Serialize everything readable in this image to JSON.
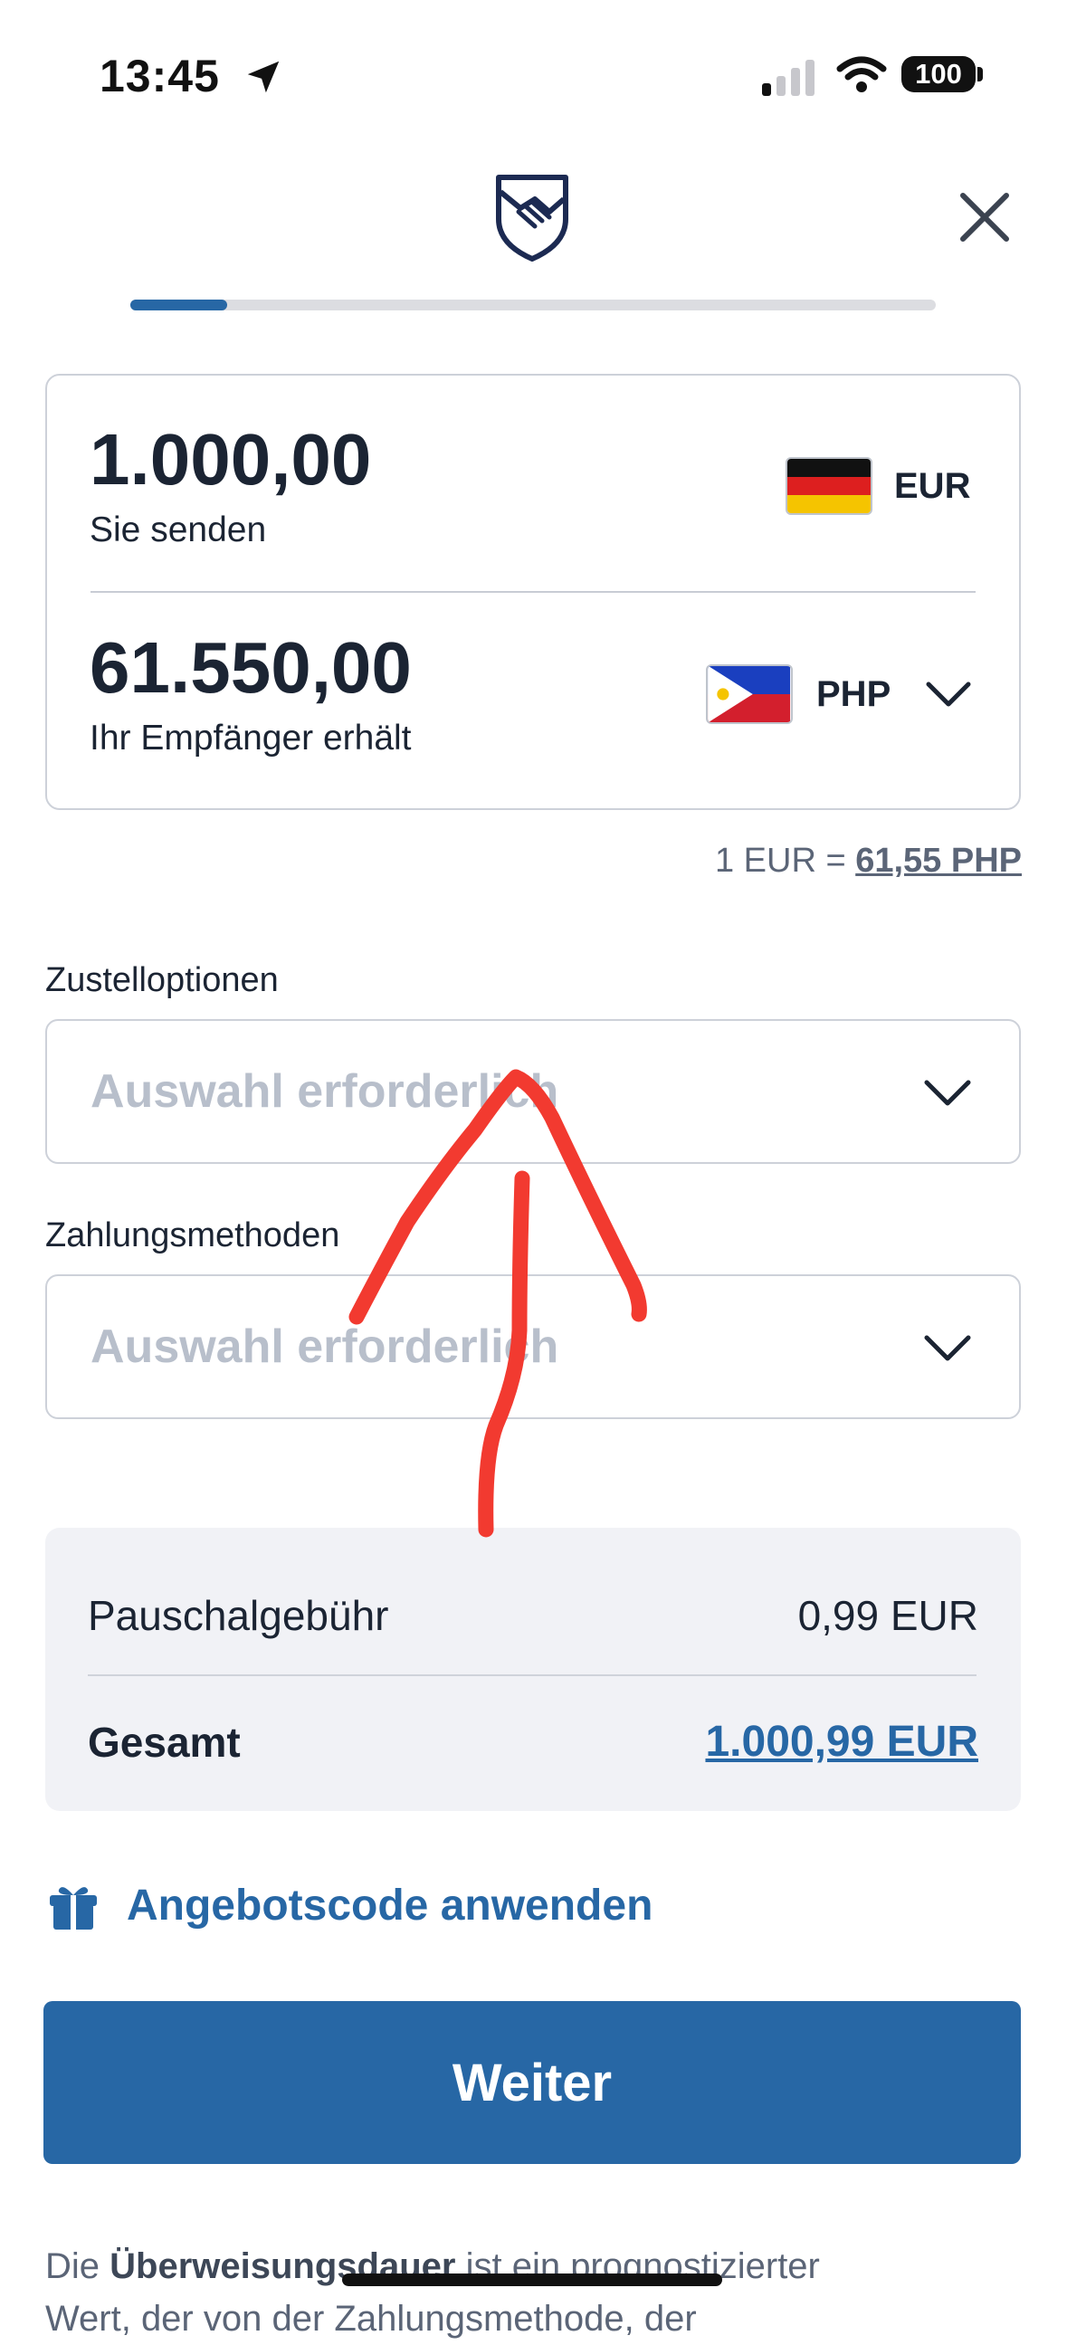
{
  "status_bar": {
    "time": "13:45",
    "battery": "100"
  },
  "progress": {
    "fraction": 0.12
  },
  "send": {
    "amount": "1.000,00",
    "label": "Sie senden",
    "currency": "EUR"
  },
  "receive": {
    "amount": "61.550,00",
    "label": "Ihr Empfänger erhält",
    "currency": "PHP"
  },
  "rate": {
    "prefix": "1 EUR = ",
    "value": "61,55 PHP"
  },
  "delivery": {
    "label": "Zustelloptionen",
    "placeholder": "Auswahl erforderlich"
  },
  "payment": {
    "label": "Zahlungsmethoden",
    "placeholder": "Auswahl erforderlich"
  },
  "summary": {
    "fee_label": "Pauschalgebühr",
    "fee_value": "0,99 EUR",
    "total_label": "Gesamt",
    "total_value": "1.000,99 EUR"
  },
  "promo": {
    "label": "Angebotscode anwenden"
  },
  "continue_button": {
    "label": "Weiter"
  },
  "footer": {
    "text_1": "Die ",
    "bold": "Überweisungsdauer",
    "text_2": " ist ein prognostizierter",
    "line_2": "Wert, der von der Zahlungsmethode, der"
  },
  "colors": {
    "accent": "#2767a5",
    "annotation": "#f23a30"
  },
  "icons": [
    "location-arrow-icon",
    "signal-icon",
    "wifi-icon",
    "handshake-shield-logo",
    "close-icon",
    "chevron-down-icon",
    "gift-icon"
  ]
}
